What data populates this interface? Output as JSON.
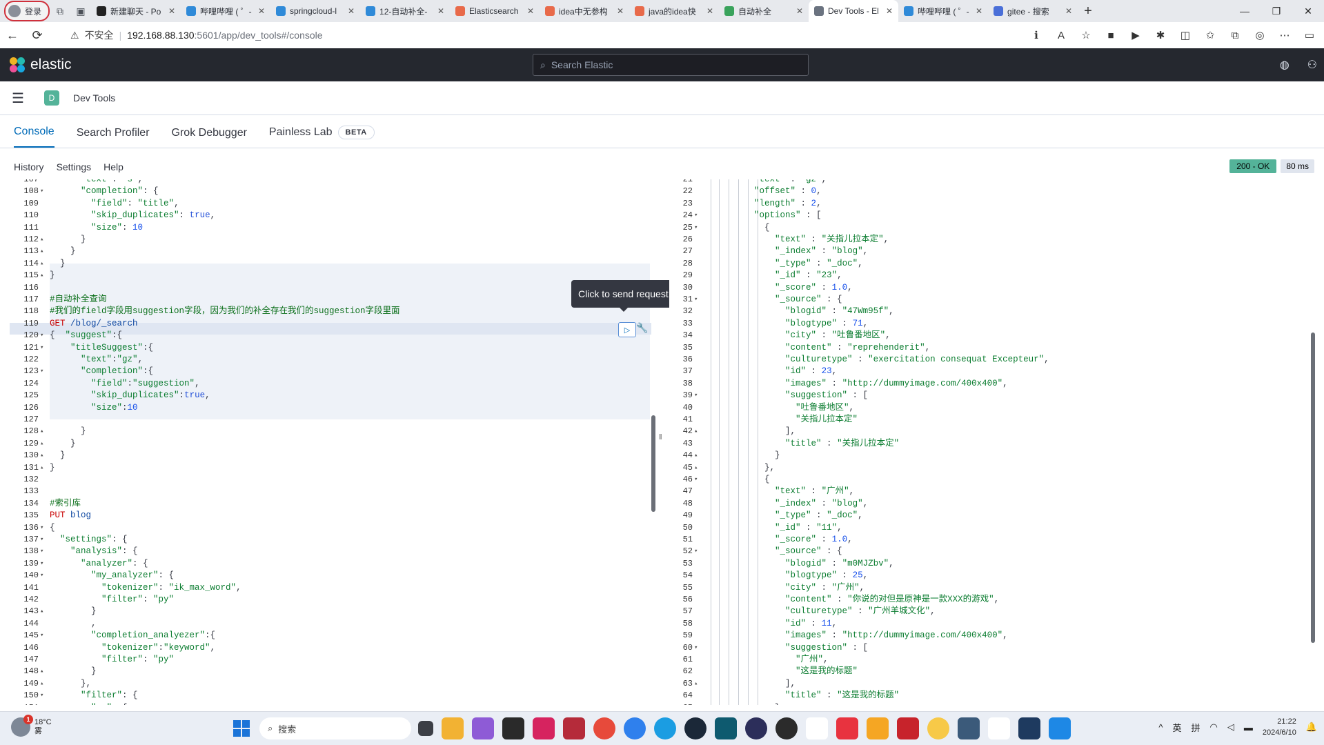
{
  "browser": {
    "profile_label": "登录",
    "tabs": [
      {
        "title": "新建聊天 - Po",
        "color": "#222222"
      },
      {
        "title": "哔哩哔哩 ( ゜-",
        "color": "#2f8ad8"
      },
      {
        "title": "springcloud-l",
        "color": "#2f8ad8"
      },
      {
        "title": "12-自动补全-",
        "color": "#2f8ad8"
      },
      {
        "title": "Elasticsearch",
        "color": "#e86a4a"
      },
      {
        "title": "idea中无参构",
        "color": "#e86a4a"
      },
      {
        "title": "java的idea快",
        "color": "#e86a4a"
      },
      {
        "title": "自动补全",
        "color": "#3aa35c"
      },
      {
        "title": "Dev Tools - El",
        "color": "#6b7380",
        "active": true
      },
      {
        "title": "哔哩哔哩 ( ゜-",
        "color": "#2f8ad8"
      },
      {
        "title": "gitee - 搜索",
        "color": "#4a6fd8"
      }
    ],
    "address": {
      "security_label": "不安全",
      "host": "192.168.88.130",
      "path": ":5601/app/dev_tools#/console"
    }
  },
  "kibana": {
    "logo_text": "elastic",
    "search_placeholder": "Search Elastic",
    "breadcrumb_badge": "D",
    "breadcrumb": "Dev Tools",
    "tabs": [
      {
        "label": "Console",
        "active": true
      },
      {
        "label": "Search Profiler"
      },
      {
        "label": "Grok Debugger"
      },
      {
        "label": "Painless Lab"
      }
    ],
    "beta_label": "BETA",
    "console_links": [
      "History",
      "Settings",
      "Help"
    ],
    "status_code": "200 - OK",
    "elapsed": "80 ms",
    "tooltip": "Click to send request"
  },
  "editor_lines": [
    {
      "n": "107",
      "f": "",
      "h": "      <span class=\"s\">\"text\"</span>: <span class=\"s\">\"s\"</span>,"
    },
    {
      "n": "108",
      "f": "▾",
      "h": "      <span class=\"s\">\"completion\"</span>: {"
    },
    {
      "n": "109",
      "f": "",
      "h": "        <span class=\"s\">\"field\"</span>: <span class=\"s\">\"title\"</span>,"
    },
    {
      "n": "110",
      "f": "",
      "h": "        <span class=\"s\">\"skip_duplicates\"</span>: <span class=\"b\">true</span>,"
    },
    {
      "n": "111",
      "f": "",
      "h": "        <span class=\"s\">\"size\"</span>: <span class=\"n\">10</span>"
    },
    {
      "n": "112",
      "f": "▴",
      "h": "      }"
    },
    {
      "n": "113",
      "f": "▴",
      "h": "    }"
    },
    {
      "n": "114",
      "f": "▴",
      "h": "  }"
    },
    {
      "n": "115",
      "f": "▴",
      "h": "}"
    },
    {
      "n": "116",
      "f": "",
      "h": ""
    },
    {
      "n": "117",
      "f": "",
      "h": "<span class=\"c\">#自动补全查询</span>"
    },
    {
      "n": "118",
      "f": "",
      "h": "<span class=\"c\">#我们的field字段用suggestion字段，因为我们的补全存在我们的suggestion字段里面</span>"
    },
    {
      "n": "119",
      "f": "",
      "h": "<span class=\"m\">GET</span> <span class=\"u\">/blog/_search</span>"
    },
    {
      "n": "120",
      "f": "▾",
      "h": "{  <span class=\"s\">\"suggest\"</span>:{"
    },
    {
      "n": "121",
      "f": "▾",
      "h": "    <span class=\"s\">\"titleSuggest\"</span>:{"
    },
    {
      "n": "122",
      "f": "",
      "h": "      <span class=\"s\">\"text\"</span>:<span class=\"s\">\"gz\"</span>,"
    },
    {
      "n": "123",
      "f": "▾",
      "h": "      <span class=\"s\">\"completion\"</span>:{"
    },
    {
      "n": "124",
      "f": "",
      "h": "        <span class=\"s\">\"field\"</span>:<span class=\"s\">\"suggestion\"</span>,"
    },
    {
      "n": "125",
      "f": "",
      "h": "        <span class=\"s\">\"skip_duplicates\"</span>:<span class=\"b\">true</span>,"
    },
    {
      "n": "126",
      "f": "",
      "h": "        <span class=\"s\">\"size\"</span>:<span class=\"n\">10</span>"
    },
    {
      "n": "127",
      "f": "",
      "h": ""
    },
    {
      "n": "128",
      "f": "▴",
      "h": "      }"
    },
    {
      "n": "129",
      "f": "▴",
      "h": "    }"
    },
    {
      "n": "130",
      "f": "▴",
      "h": "  }"
    },
    {
      "n": "131",
      "f": "▴",
      "h": "}"
    },
    {
      "n": "132",
      "f": "",
      "h": ""
    },
    {
      "n": "133",
      "f": "",
      "h": ""
    },
    {
      "n": "134",
      "f": "",
      "h": "<span class=\"c\">#索引库</span>"
    },
    {
      "n": "135",
      "f": "",
      "h": "<span class=\"m\">PUT</span> <span class=\"u\">blog</span>"
    },
    {
      "n": "136",
      "f": "▾",
      "h": "{"
    },
    {
      "n": "137",
      "f": "▾",
      "h": "  <span class=\"s\">\"settings\"</span>: {"
    },
    {
      "n": "138",
      "f": "▾",
      "h": "    <span class=\"s\">\"analysis\"</span>: {"
    },
    {
      "n": "139",
      "f": "▾",
      "h": "      <span class=\"s\">\"analyzer\"</span>: {"
    },
    {
      "n": "140",
      "f": "▾",
      "h": "        <span class=\"s\">\"my_analyzer\"</span>: {"
    },
    {
      "n": "141",
      "f": "",
      "h": "          <span class=\"s\">\"tokenizer\"</span>: <span class=\"s\">\"ik_max_word\"</span>,"
    },
    {
      "n": "142",
      "f": "",
      "h": "          <span class=\"s\">\"filter\"</span>: <span class=\"s\">\"py\"</span>"
    },
    {
      "n": "143",
      "f": "▴",
      "h": "        }"
    },
    {
      "n": "144",
      "f": "",
      "h": "        ,"
    },
    {
      "n": "145",
      "f": "▾",
      "h": "        <span class=\"s\">\"completion_analyezer\"</span>:{"
    },
    {
      "n": "146",
      "f": "",
      "h": "          <span class=\"s\">\"tokenizer\"</span>:<span class=\"s\">\"keyword\"</span>,"
    },
    {
      "n": "147",
      "f": "",
      "h": "          <span class=\"s\">\"filter\"</span>: <span class=\"s\">\"py\"</span>"
    },
    {
      "n": "148",
      "f": "▴",
      "h": "        }"
    },
    {
      "n": "149",
      "f": "▴",
      "h": "      },"
    },
    {
      "n": "150",
      "f": "▾",
      "h": "      <span class=\"s\">\"filter\"</span>: {"
    },
    {
      "n": "151",
      "f": "▾",
      "h": "        <span class=\"s\">\"py\"</span>: {"
    }
  ],
  "response_lines": [
    {
      "n": "21",
      "f": "",
      "h": "          <span class=\"s\">\"text\"</span> : <span class=\"s\">\"gz\"</span>,"
    },
    {
      "n": "22",
      "f": "",
      "h": "          <span class=\"s\">\"offset\"</span> : <span class=\"n\">0</span>,"
    },
    {
      "n": "23",
      "f": "",
      "h": "          <span class=\"s\">\"length\"</span> : <span class=\"n\">2</span>,"
    },
    {
      "n": "24",
      "f": "▾",
      "h": "          <span class=\"s\">\"options\"</span> : ["
    },
    {
      "n": "25",
      "f": "▾",
      "h": "            {"
    },
    {
      "n": "26",
      "f": "",
      "h": "              <span class=\"s\">\"text\"</span> : <span class=\"s\">\"关指儿拉本定\"</span>,"
    },
    {
      "n": "27",
      "f": "",
      "h": "              <span class=\"s\">\"_index\"</span> : <span class=\"s\">\"blog\"</span>,"
    },
    {
      "n": "28",
      "f": "",
      "h": "              <span class=\"s\">\"_type\"</span> : <span class=\"s\">\"_doc\"</span>,"
    },
    {
      "n": "29",
      "f": "",
      "h": "              <span class=\"s\">\"_id\"</span> : <span class=\"s\">\"23\"</span>,"
    },
    {
      "n": "30",
      "f": "",
      "h": "              <span class=\"s\">\"_score\"</span> : <span class=\"n\">1.0</span>,"
    },
    {
      "n": "31",
      "f": "▾",
      "h": "              <span class=\"s\">\"_source\"</span> : {"
    },
    {
      "n": "32",
      "f": "",
      "h": "                <span class=\"s\">\"blogid\"</span> : <span class=\"s\">\"47Wm95f\"</span>,"
    },
    {
      "n": "33",
      "f": "",
      "h": "                <span class=\"s\">\"blogtype\"</span> : <span class=\"n\">71</span>,"
    },
    {
      "n": "34",
      "f": "",
      "h": "                <span class=\"s\">\"city\"</span> : <span class=\"s\">\"吐鲁番地区\"</span>,"
    },
    {
      "n": "35",
      "f": "",
      "h": "                <span class=\"s\">\"content\"</span> : <span class=\"s\">\"reprehenderit\"</span>,"
    },
    {
      "n": "36",
      "f": "",
      "h": "                <span class=\"s\">\"culturetype\"</span> : <span class=\"s\">\"exercitation consequat Excepteur\"</span>,"
    },
    {
      "n": "37",
      "f": "",
      "h": "                <span class=\"s\">\"id\"</span> : <span class=\"n\">23</span>,"
    },
    {
      "n": "38",
      "f": "",
      "h": "                <span class=\"s\">\"images\"</span> : <span class=\"s\">\"http://dummyimage.com/400x400\"</span>,"
    },
    {
      "n": "39",
      "f": "▾",
      "h": "                <span class=\"s\">\"suggestion\"</span> : ["
    },
    {
      "n": "40",
      "f": "",
      "h": "                  <span class=\"s\">\"吐鲁番地区\"</span>,"
    },
    {
      "n": "41",
      "f": "",
      "h": "                  <span class=\"s\">\"关指儿拉本定\"</span>"
    },
    {
      "n": "42",
      "f": "▴",
      "h": "                ],"
    },
    {
      "n": "43",
      "f": "",
      "h": "                <span class=\"s\">\"title\"</span> : <span class=\"s\">\"关指儿拉本定\"</span>"
    },
    {
      "n": "44",
      "f": "▴",
      "h": "              }"
    },
    {
      "n": "45",
      "f": "▴",
      "h": "            },"
    },
    {
      "n": "46",
      "f": "▾",
      "h": "            {"
    },
    {
      "n": "47",
      "f": "",
      "h": "              <span class=\"s\">\"text\"</span> : <span class=\"s\">\"广州\"</span>,"
    },
    {
      "n": "48",
      "f": "",
      "h": "              <span class=\"s\">\"_index\"</span> : <span class=\"s\">\"blog\"</span>,"
    },
    {
      "n": "49",
      "f": "",
      "h": "              <span class=\"s\">\"_type\"</span> : <span class=\"s\">\"_doc\"</span>,"
    },
    {
      "n": "50",
      "f": "",
      "h": "              <span class=\"s\">\"_id\"</span> : <span class=\"s\">\"11\"</span>,"
    },
    {
      "n": "51",
      "f": "",
      "h": "              <span class=\"s\">\"_score\"</span> : <span class=\"n\">1.0</span>,"
    },
    {
      "n": "52",
      "f": "▾",
      "h": "              <span class=\"s\">\"_source\"</span> : {"
    },
    {
      "n": "53",
      "f": "",
      "h": "                <span class=\"s\">\"blogid\"</span> : <span class=\"s\">\"m0MJZbv\"</span>,"
    },
    {
      "n": "54",
      "f": "",
      "h": "                <span class=\"s\">\"blogtype\"</span> : <span class=\"n\">25</span>,"
    },
    {
      "n": "55",
      "f": "",
      "h": "                <span class=\"s\">\"city\"</span> : <span class=\"s\">\"广州\"</span>,"
    },
    {
      "n": "56",
      "f": "",
      "h": "                <span class=\"s\">\"content\"</span> : <span class=\"s\">\"你说的对但是原神是一款XXX的游戏\"</span>,"
    },
    {
      "n": "57",
      "f": "",
      "h": "                <span class=\"s\">\"culturetype\"</span> : <span class=\"s\">\"广州羊城文化\"</span>,"
    },
    {
      "n": "58",
      "f": "",
      "h": "                <span class=\"s\">\"id\"</span> : <span class=\"n\">11</span>,"
    },
    {
      "n": "59",
      "f": "",
      "h": "                <span class=\"s\">\"images\"</span> : <span class=\"s\">\"http://dummyimage.com/400x400\"</span>,"
    },
    {
      "n": "60",
      "f": "▾",
      "h": "                <span class=\"s\">\"suggestion\"</span> : ["
    },
    {
      "n": "61",
      "f": "",
      "h": "                  <span class=\"s\">\"广州\"</span>,"
    },
    {
      "n": "62",
      "f": "",
      "h": "                  <span class=\"s\">\"这是我的标题\"</span>"
    },
    {
      "n": "63",
      "f": "▴",
      "h": "                ],"
    },
    {
      "n": "64",
      "f": "",
      "h": "                <span class=\"s\">\"title\"</span> : <span class=\"s\">\"这是我的标题\"</span>"
    },
    {
      "n": "65",
      "f": "▴",
      "h": "              }"
    }
  ],
  "taskbar": {
    "weather_badge": "1",
    "temperature": "18°C",
    "condition": "雾",
    "search_placeholder": "搜索",
    "ime_lang": "英",
    "ime_mode": "拼",
    "time": "21:22",
    "date": "2024/6/10"
  }
}
